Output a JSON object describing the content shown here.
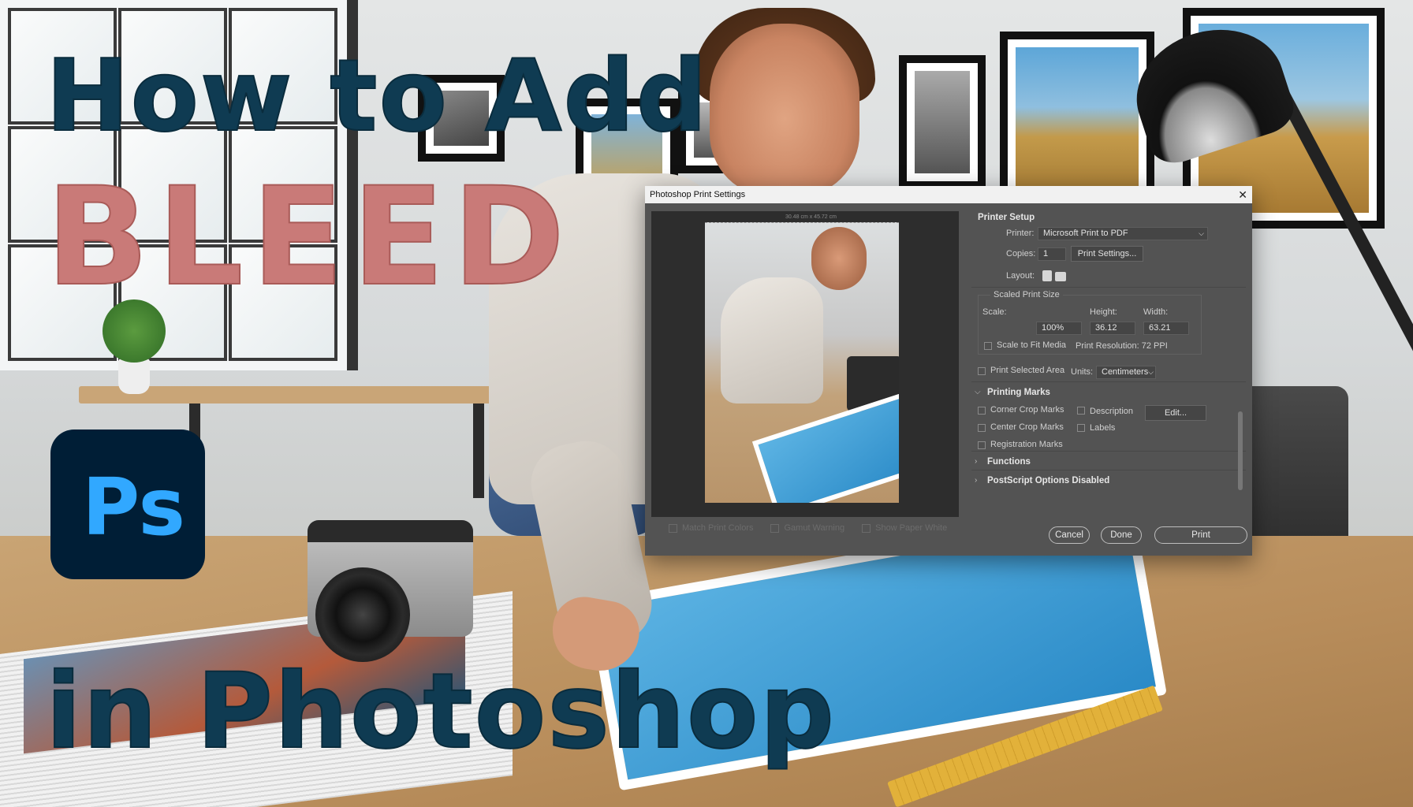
{
  "thumbnail": {
    "title_line1": "How to Add",
    "title_line2": "BLEED",
    "title_line3": "in Photoshop",
    "ps_logo_text": "Ps",
    "colors": {
      "title_dark": "#0f3b52",
      "title_pink": "#c97a78",
      "ps_bg": "#001e36",
      "ps_text": "#31a8ff"
    }
  },
  "dialog": {
    "title": "Photoshop Print Settings",
    "close_icon": "close-icon",
    "preview": {
      "ruler_label": "30.48 cm x 45.72 cm"
    },
    "bottom_options": {
      "match_print_colors": "Match Print Colors",
      "gamut_warning": "Gamut Warning",
      "show_paper_white": "Show Paper White"
    },
    "printer_setup": {
      "section_title": "Printer Setup",
      "printer_label": "Printer:",
      "printer_value": "Microsoft Print to PDF",
      "copies_label": "Copies:",
      "copies_value": "1",
      "print_settings_button": "Print Settings...",
      "layout_label": "Layout:"
    },
    "scaled_print_size": {
      "section_title": "Scaled Print Size",
      "scale_label": "Scale:",
      "height_label": "Height:",
      "width_label": "Width:",
      "scale_value": "100%",
      "height_value": "36.12",
      "width_value": "63.21",
      "scale_to_fit": "Scale to Fit Media",
      "print_resolution": "Print Resolution: 72 PPI"
    },
    "print_selected_area": "Print Selected Area",
    "units_label": "Units:",
    "units_value": "Centimeters",
    "printing_marks": {
      "section_title": "Printing Marks",
      "corner_crop": "Corner Crop Marks",
      "center_crop": "Center Crop Marks",
      "registration": "Registration Marks",
      "description": "Description",
      "labels": "Labels",
      "edit_button": "Edit..."
    },
    "functions": "Functions",
    "postscript": "PostScript Options Disabled",
    "buttons": {
      "cancel": "Cancel",
      "done": "Done",
      "print": "Print"
    }
  }
}
